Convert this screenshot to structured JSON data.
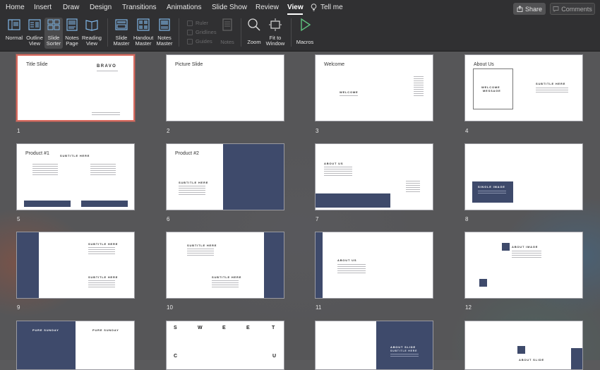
{
  "tabs": [
    "Home",
    "Insert",
    "Draw",
    "Design",
    "Transitions",
    "Animations",
    "Slide Show",
    "Review",
    "View"
  ],
  "tell_me": "Tell me",
  "share_label": "Share",
  "comments_label": "Comments",
  "tools": {
    "normal": [
      "Normal"
    ],
    "outline": [
      "Outline",
      "View"
    ],
    "sorter": [
      "Slide",
      "Sorter"
    ],
    "notes_page": [
      "Notes",
      "Page"
    ],
    "reading": [
      "Reading",
      "View"
    ],
    "slide_master": [
      "Slide",
      "Master"
    ],
    "handout_master": [
      "Handout",
      "Master"
    ],
    "notes_master": [
      "Notes",
      "Master"
    ],
    "ruler": "Ruler",
    "gridlines": "Gridlines",
    "guides": "Guides",
    "notes": "Notes",
    "zoom": "Zoom",
    "fit": [
      "Fit to",
      "Window"
    ],
    "macros": "Macros"
  },
  "slides": {
    "s1": {
      "num": "1",
      "title": "Title Slide",
      "logo": "BRAVO"
    },
    "s2": {
      "num": "2",
      "title": "Picture Slide"
    },
    "s3": {
      "num": "3",
      "title": "Welcome",
      "heading": "WELCOME"
    },
    "s4": {
      "num": "4",
      "title": "About Us",
      "box1": "WELCOME",
      "box2": "MESSAGE",
      "sub": "SUBTITLE HERE"
    },
    "s5": {
      "num": "5",
      "title": "Product #1",
      "sub": "SUBTITLE HERE"
    },
    "s6": {
      "num": "6",
      "title": "Product #2",
      "sub": "SUBTITLE HERE"
    },
    "s7": {
      "num": "7",
      "heading": "ABOUT US"
    },
    "s8": {
      "num": "8",
      "heading": "SINGLE IMAGE"
    },
    "s9": {
      "num": "9",
      "sub1": "SUBTITLE HERE",
      "sub2": "SUBTITLE HERE"
    },
    "s10": {
      "num": "10",
      "sub1": "SUBTITLE HERE",
      "sub2": "SUBTITLE HERE"
    },
    "s11": {
      "num": "11",
      "heading": "ABOUT US"
    },
    "s12": {
      "num": "12",
      "heading": "ABOUT IMAGE"
    },
    "s13": {
      "left": "PURE SUNDAY",
      "right": "PURE SUNDAY"
    },
    "s14": {
      "row1": [
        "S",
        "W",
        "E",
        "E",
        "T"
      ],
      "row2": [
        "C",
        "U"
      ]
    },
    "s15": {
      "heading": "ABOUT SLIDE",
      "sub": "SUBTITLE HERE"
    },
    "s16": {
      "heading": "ABOUT SLIDE"
    }
  },
  "colors": {
    "accent_navy": "#3e4a6b",
    "selection": "#d86a5e"
  }
}
